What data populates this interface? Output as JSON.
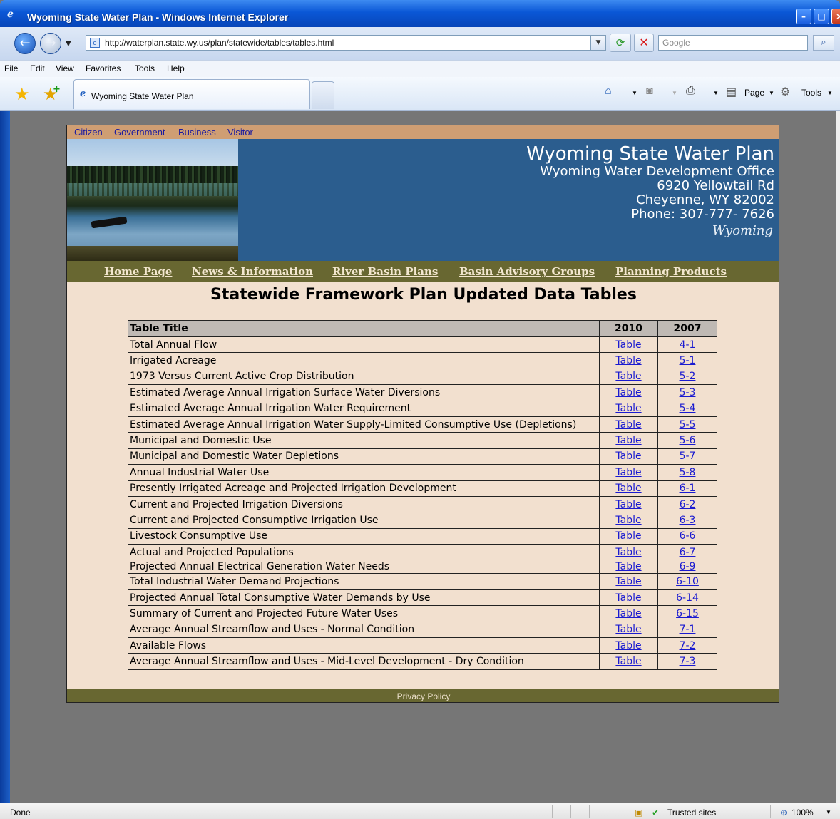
{
  "window": {
    "title": "Wyoming State Water Plan - Windows Internet Explorer",
    "address": "http://waterplan.state.wy.us/plan/statewide/tables/tables.html",
    "search_placeholder": "Google",
    "tab_title": "Wyoming State Water Plan"
  },
  "menu": [
    "File",
    "Edit",
    "View",
    "Favorites",
    "Tools",
    "Help"
  ],
  "commandbar": {
    "page_label": "Page",
    "tools_label": "Tools"
  },
  "status": {
    "text": "Done",
    "zone": "Trusted sites",
    "zoom": "100%"
  },
  "site": {
    "topnav": [
      "Citizen",
      "Government",
      "Business",
      "Visitor"
    ],
    "banner": {
      "title": "Wyoming State Water Plan",
      "office": "Wyoming Water Development Office",
      "address1": "6920 Yellowtail Rd",
      "address2": "Cheyenne, WY 82002",
      "phone": "Phone: 307-777- 7626",
      "signature": "Wyoming"
    },
    "mainnav": [
      "Home Page",
      "News & Information",
      "River Basin Plans",
      "Basin Advisory Groups",
      "Planning Products"
    ],
    "page_title": "Statewide Framework Plan Updated Data Tables",
    "table": {
      "headers": [
        "Table Title",
        "2010",
        "2007"
      ],
      "rows": [
        [
          "Total Annual Flow",
          "Table",
          "4-1"
        ],
        [
          "Irrigated Acreage",
          "Table",
          "5-1"
        ],
        [
          "1973 Versus Current Active Crop Distribution",
          "Table",
          "5-2"
        ],
        [
          "Estimated Average Annual Irrigation Surface Water Diversions",
          "Table",
          "5-3"
        ],
        [
          "Estimated Average Annual Irrigation Water Requirement",
          "Table",
          "5-4"
        ],
        [
          "Estimated Average Annual Irrigation Water Supply-Limited Consumptive Use (Depletions)",
          "Table",
          "5-5"
        ],
        [
          "Municipal and Domestic Use",
          "Table",
          "5-6"
        ],
        [
          "Municipal and Domestic Water Depletions",
          "Table",
          "5-7"
        ],
        [
          "Annual Industrial Water Use",
          "Table",
          "5-8"
        ],
        [
          "Presently Irrigated Acreage and Projected Irrigation Development",
          "Table",
          "6-1"
        ],
        [
          "Current and Projected Irrigation Diversions",
          "Table",
          "6-2"
        ],
        [
          "Current and Projected Consumptive Irrigation Use",
          "Table",
          "6-3"
        ],
        [
          "Livestock Consumptive Use",
          "Table",
          "6-6"
        ],
        [
          "Actual and Projected Populations",
          "Table",
          "6-7"
        ],
        [
          "Projected Annual Electrical Generation Water Needs",
          "Table",
          "6-9"
        ],
        [
          "Total Industrial Water Demand Projections",
          "Table",
          "6-10"
        ],
        [
          "Projected Annual Total Consumptive Water Demands by Use",
          "Table",
          "6-14"
        ],
        [
          "Summary of Current and Projected Future Water Uses",
          "Table",
          "6-15"
        ],
        [
          "Average Annual Streamflow and Uses - Normal Condition",
          "Table",
          "7-1"
        ],
        [
          "Available Flows",
          "Table",
          "7-2"
        ],
        [
          "Average Annual Streamflow and Uses - Mid-Level Development - Dry Condition",
          "Table",
          "7-3"
        ]
      ]
    },
    "footer": "Privacy Policy"
  }
}
